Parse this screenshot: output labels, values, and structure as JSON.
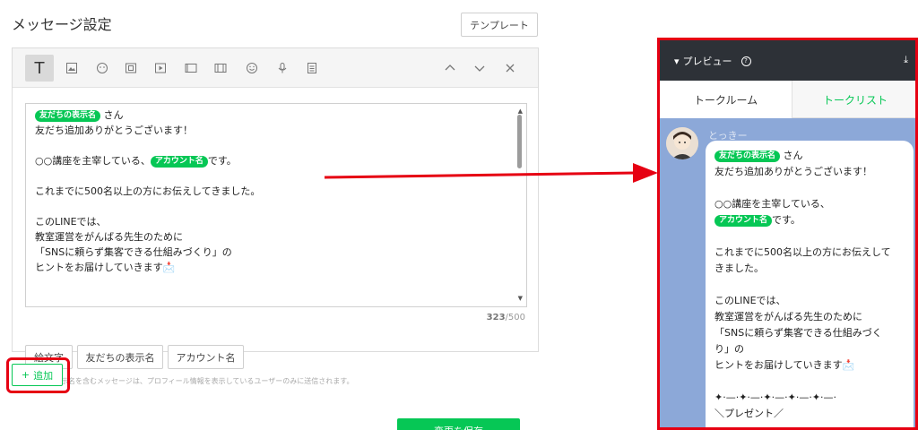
{
  "page": {
    "title": "メッセージ設定",
    "template_label": "テンプレート"
  },
  "toolbar": {
    "text_tool": "T",
    "icons": [
      "image-icon",
      "sticker-icon",
      "coupon-icon",
      "video-icon",
      "richmessage-icon",
      "cardtype-icon",
      "richvideo-icon",
      "emoji-icon",
      "voice-icon",
      "survey-icon"
    ],
    "controls": [
      "chevron-up-icon",
      "chevron-down-icon",
      "close-icon"
    ]
  },
  "editor": {
    "lines": [
      {
        "tag": "友だちの表示名",
        "text": "さん"
      },
      {
        "text": "友だち追加ありがとうございます！"
      },
      {
        "text": ""
      },
      {
        "text": "○○講座を主宰している、",
        "tag": "アカウント名",
        "after": "です。"
      },
      {
        "text": ""
      },
      {
        "text": "これまでに500名以上の方にお伝えしてきました。"
      },
      {
        "text": ""
      },
      {
        "text": "このLINEでは、"
      },
      {
        "text": "教室運営をがんばる先生のために"
      },
      {
        "text": "「SNSに頼らず集客できる仕組みづくり」の"
      },
      {
        "text": "ヒントをお届けしていきます📩"
      }
    ],
    "count": "323",
    "max": "/500"
  },
  "inserts": {
    "emoji": "絵文字",
    "friend_name": "友だちの表示名",
    "account_name": "アカウント名"
  },
  "note": "友だちの表示名を含むメッセージは、プロフィール情報を表示しているユーザーのみに送信されます。",
  "add_button": {
    "icon": "+",
    "label": "追加"
  },
  "save_button": "変更を保存",
  "preview": {
    "title": "プレビュー",
    "help": "?",
    "download": "⤓",
    "tabs": [
      "トークルーム",
      "トークリスト"
    ],
    "sender": "とっきー",
    "lines": [
      {
        "tag": "友だちの表示名",
        "text": "さん"
      },
      {
        "text": "友だち追加ありがとうございます！"
      },
      {
        "text": ""
      },
      {
        "text": "○○講座を主宰している、"
      },
      {
        "tag": "アカウント名",
        "text": "です。"
      },
      {
        "text": ""
      },
      {
        "text": "これまでに500名以上の方にお伝えして"
      },
      {
        "text": "きました。"
      },
      {
        "text": ""
      },
      {
        "text": "このLINEでは、"
      },
      {
        "text": "教室運営をがんばる先生のために"
      },
      {
        "text": "「SNSに頼らず集客できる仕組みづく"
      },
      {
        "text": "り」の"
      },
      {
        "text": "ヒントをお届けしていきます📩"
      },
      {
        "text": ""
      },
      {
        "text": "✦‧—‧✦‧—‧✦‧—‧✦‧—‧✦‧—‧"
      },
      {
        "text": "＼プレゼント／"
      }
    ]
  },
  "colors": {
    "accent": "#06c755",
    "highlight": "#e60012",
    "preview_bg": "#8ca8d8",
    "preview_header": "#2d3137"
  }
}
